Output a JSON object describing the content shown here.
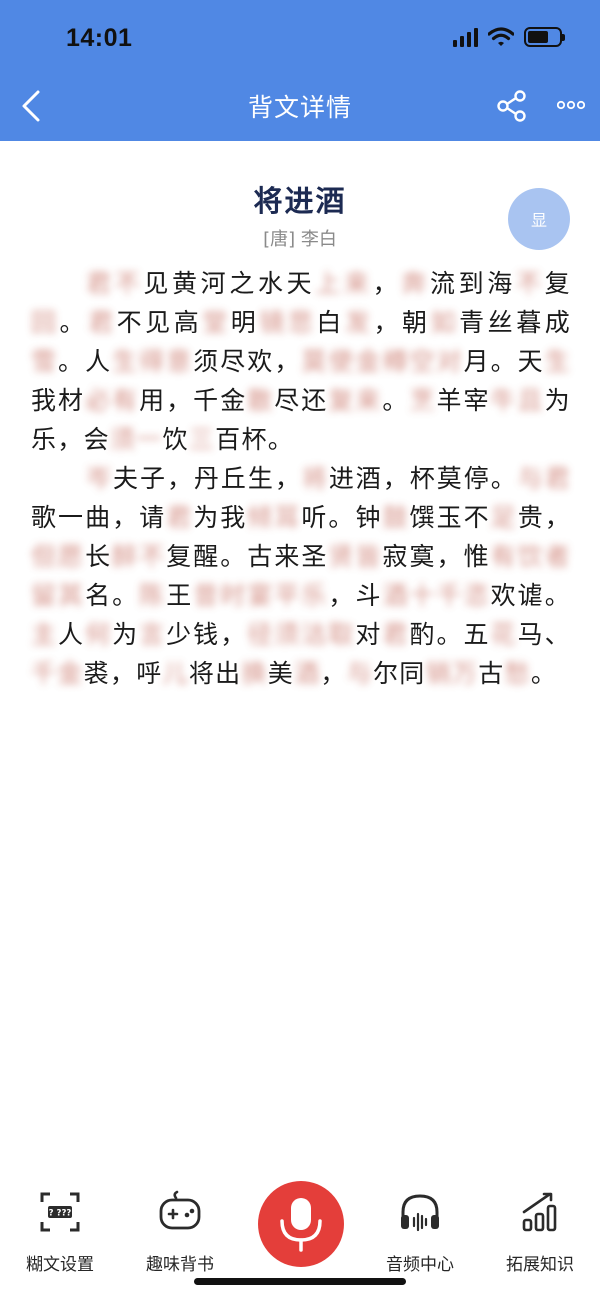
{
  "status": {
    "time": "14:01"
  },
  "nav": {
    "title": "背文详情"
  },
  "poem": {
    "title": "将进酒",
    "author": "[唐] 李白",
    "show_button": "显",
    "paragraphs": [
      [
        {
          "t": "君不",
          "h": true
        },
        {
          "t": "见黄河之水天"
        },
        {
          "t": "上来",
          "h": true
        },
        {
          "t": "，"
        },
        {
          "t": "奔",
          "h": true
        },
        {
          "t": "流到海"
        },
        {
          "t": "不",
          "h": true
        },
        {
          "t": "复"
        },
        {
          "t": "回",
          "h": true
        },
        {
          "t": "。"
        },
        {
          "t": "君",
          "h": true
        },
        {
          "t": "不见高"
        },
        {
          "t": "堂",
          "h": true
        },
        {
          "t": "明"
        },
        {
          "t": "镜悲",
          "h": true
        },
        {
          "t": "白"
        },
        {
          "t": "发",
          "h": true
        },
        {
          "t": "，朝"
        },
        {
          "t": "如",
          "h": true
        },
        {
          "t": "青丝暮成"
        },
        {
          "t": "雪",
          "h": true
        },
        {
          "t": "。人"
        },
        {
          "t": "生得意",
          "h": true
        },
        {
          "t": "须尽欢，"
        },
        {
          "t": "莫使金樽空对",
          "h": true
        },
        {
          "t": "月。天"
        },
        {
          "t": "生",
          "h": true
        },
        {
          "t": "我材"
        },
        {
          "t": "必有",
          "h": true
        },
        {
          "t": "用，千金"
        },
        {
          "t": "散",
          "h": true
        },
        {
          "t": "尽还"
        },
        {
          "t": "复来",
          "h": true
        },
        {
          "t": "。"
        },
        {
          "t": "烹",
          "h": true
        },
        {
          "t": "羊宰"
        },
        {
          "t": "牛且",
          "h": true
        },
        {
          "t": "为乐，会"
        },
        {
          "t": "须一",
          "h": true
        },
        {
          "t": "饮"
        },
        {
          "t": "三",
          "h": true
        },
        {
          "t": "百杯。"
        }
      ],
      [
        {
          "t": "岑",
          "h": true
        },
        {
          "t": "夫子，丹丘生，"
        },
        {
          "t": "将",
          "h": true
        },
        {
          "t": "进酒，杯莫停。"
        },
        {
          "t": "与君",
          "h": true
        },
        {
          "t": "歌一曲，请"
        },
        {
          "t": "君",
          "h": true
        },
        {
          "t": "为我"
        },
        {
          "t": "倾耳",
          "h": true
        },
        {
          "t": "听。钟"
        },
        {
          "t": "鼓",
          "h": true
        },
        {
          "t": "馔玉不"
        },
        {
          "t": "足",
          "h": true
        },
        {
          "t": "贵，"
        },
        {
          "t": "但愿",
          "h": true
        },
        {
          "t": "长"
        },
        {
          "t": "醉不",
          "h": true
        },
        {
          "t": "复醒。古来圣"
        },
        {
          "t": "贤皆",
          "h": true
        },
        {
          "t": "寂寞，惟"
        },
        {
          "t": "有饮者留其",
          "h": true
        },
        {
          "t": "名。"
        },
        {
          "t": "陈",
          "h": true
        },
        {
          "t": "王"
        },
        {
          "t": "昔时宴平乐",
          "h": true
        },
        {
          "t": "，斗"
        },
        {
          "t": "酒十千恣",
          "h": true
        },
        {
          "t": "欢谑。"
        },
        {
          "t": "主",
          "h": true
        },
        {
          "t": "人"
        },
        {
          "t": "何",
          "h": true
        },
        {
          "t": "为"
        },
        {
          "t": "言",
          "h": true
        },
        {
          "t": "少钱，"
        },
        {
          "t": "径须沽取",
          "h": true
        },
        {
          "t": "对"
        },
        {
          "t": "君",
          "h": true
        },
        {
          "t": "酌。五"
        },
        {
          "t": "花",
          "h": true
        },
        {
          "t": "马、"
        },
        {
          "t": "千金",
          "h": true
        },
        {
          "t": "裘，呼"
        },
        {
          "t": "儿",
          "h": true
        },
        {
          "t": "将出"
        },
        {
          "t": "换",
          "h": true
        },
        {
          "t": "美"
        },
        {
          "t": "酒",
          "h": true
        },
        {
          "t": "，"
        },
        {
          "t": "与",
          "h": true
        },
        {
          "t": "尔同"
        },
        {
          "t": "销万",
          "h": true
        },
        {
          "t": "古"
        },
        {
          "t": "愁",
          "h": true
        },
        {
          "t": "。"
        }
      ]
    ]
  },
  "toolbar": {
    "blur_settings": "糊文设置",
    "fun_recite": "趣味背书",
    "audio_center": "音频中心",
    "extended_knowledge": "拓展知识"
  },
  "colors": {
    "header": "#5088e4",
    "mic": "#e43e3a",
    "show_button": "#a9c4f1",
    "title": "#1c2a52"
  }
}
